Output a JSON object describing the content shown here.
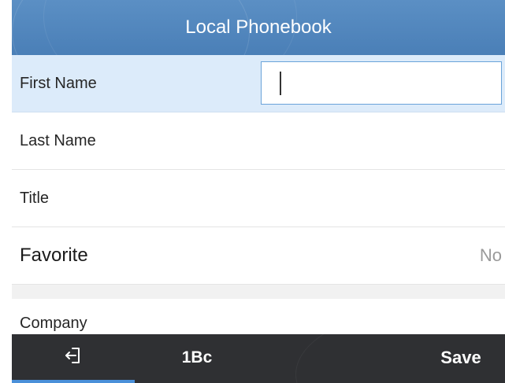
{
  "header": {
    "title": "Local Phonebook"
  },
  "form": {
    "rows": [
      {
        "label": "First Name",
        "value": ""
      },
      {
        "label": "Last Name",
        "value": ""
      },
      {
        "label": "Title",
        "value": ""
      },
      {
        "label": "Favorite",
        "value": "No"
      },
      {
        "label": "Company",
        "value": ""
      }
    ]
  },
  "softkeys": {
    "back_icon": "back-arrow-icon",
    "ime_label": "1Bc",
    "save_label": "Save"
  },
  "colors": {
    "header": "#4a7fb7",
    "selected_row": "#dcebfa",
    "softkey_bar": "#2f3033",
    "accent": "#4a90d9"
  }
}
